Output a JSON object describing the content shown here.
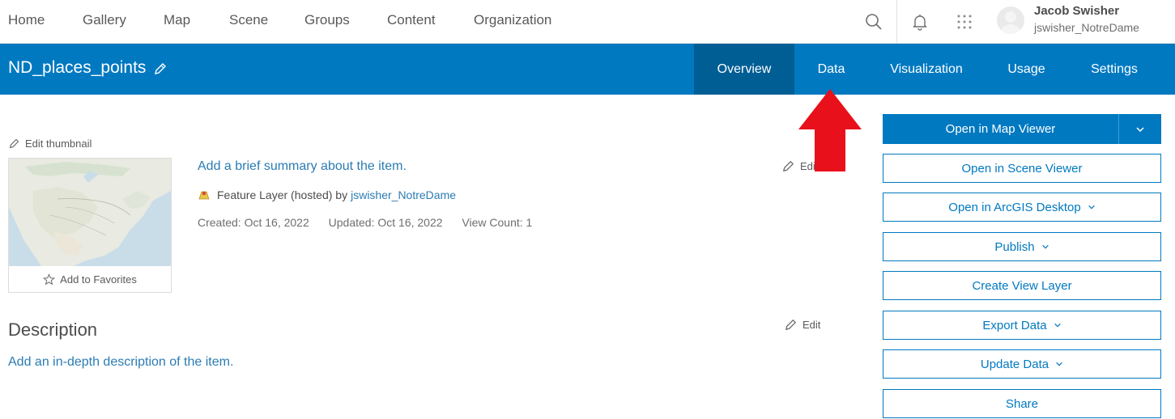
{
  "nav": {
    "links": [
      "Home",
      "Gallery",
      "Map",
      "Scene",
      "Groups",
      "Content",
      "Organization"
    ],
    "user": {
      "name": "Jacob Swisher",
      "handle": "jswisher_NotreDame"
    }
  },
  "header": {
    "title": "ND_places_points",
    "tabs": [
      "Overview",
      "Data",
      "Visualization",
      "Usage",
      "Settings"
    ],
    "active_tab": "Overview",
    "color": "#0079c1"
  },
  "thumbnail": {
    "edit_label": "Edit thumbnail",
    "favorites_label": "Add to Favorites"
  },
  "summary": {
    "placeholder_link": "Add a brief summary about the item.",
    "edit_label": "Edit",
    "item_type": "Feature Layer (hosted) by",
    "owner": "jswisher_NotreDame",
    "created": "Created: Oct 16, 2022",
    "updated": "Updated: Oct 16, 2022",
    "view_count": "View Count: 1"
  },
  "description": {
    "heading": "Description",
    "placeholder_link": "Add an in-depth description of the item.",
    "edit_label": "Edit"
  },
  "actions": {
    "open_map_viewer": "Open in Map Viewer",
    "open_scene_viewer": "Open in Scene Viewer",
    "open_arcgis_desktop": "Open in ArcGIS Desktop",
    "publish": "Publish",
    "create_view_layer": "Create View Layer",
    "export_data": "Export Data",
    "update_data": "Update Data",
    "share": "Share"
  },
  "annotation": {
    "arrow_color": "#e8101a"
  }
}
